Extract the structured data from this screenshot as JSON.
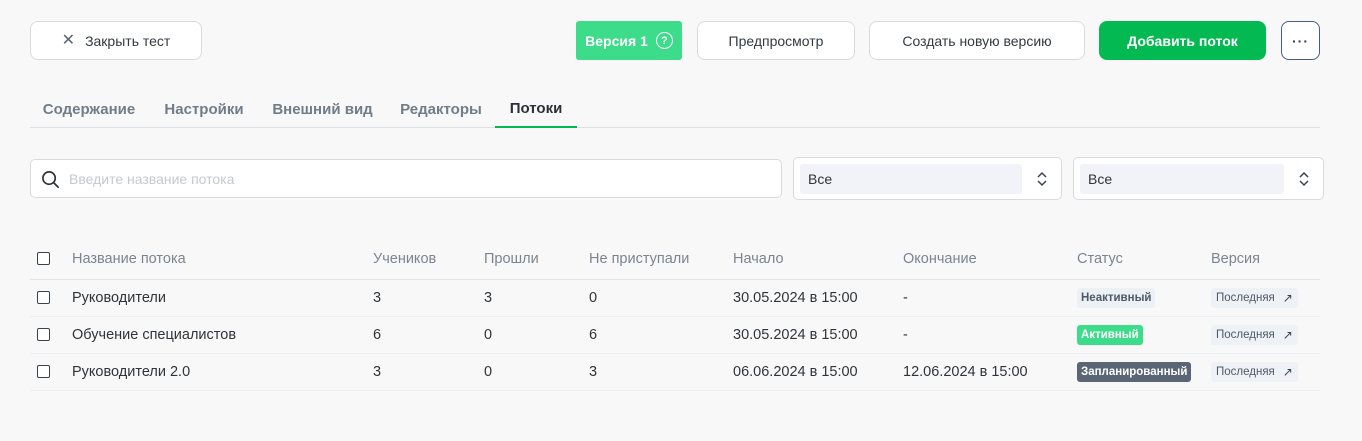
{
  "toolbar": {
    "close_label": "Закрыть тест",
    "version_label": "Версия 1",
    "preview_label": "Предпросмотр",
    "new_version_label": "Создать новую версию",
    "add_stream_label": "Добавить поток",
    "more_label": "···"
  },
  "tabs": [
    {
      "label": "Содержание",
      "active": false
    },
    {
      "label": "Настройки",
      "active": false
    },
    {
      "label": "Внешний вид",
      "active": false
    },
    {
      "label": "Редакторы",
      "active": false
    },
    {
      "label": "Потоки",
      "active": true
    }
  ],
  "filters": {
    "search_placeholder": "Введите название потока",
    "search_value": "",
    "select1_value": "Все",
    "select2_value": "Все"
  },
  "table": {
    "columns": [
      "Название потока",
      "Учеников",
      "Прошли",
      "Не приступали",
      "Начало",
      "Окончание",
      "Статус",
      "Версия"
    ],
    "rows": [
      {
        "name": "Руководители",
        "students": "3",
        "passed": "3",
        "not_started": "0",
        "start": "30.05.2024 в 15:00",
        "end": "-",
        "status": "Неактивный",
        "status_type": "inactive",
        "version": "Последняя"
      },
      {
        "name": "Обучение специалистов",
        "students": "6",
        "passed": "0",
        "not_started": "6",
        "start": "30.05.2024 в 15:00",
        "end": "-",
        "status": "Активный",
        "status_type": "active",
        "version": "Последняя"
      },
      {
        "name": "Руководители 2.0",
        "students": "3",
        "passed": "0",
        "not_started": "3",
        "start": "06.06.2024 в 15:00",
        "end": "12.06.2024 в 15:00",
        "status": "Запланированный",
        "status_type": "planned",
        "version": "Последняя"
      }
    ]
  },
  "colors": {
    "primary_green": "#03b952",
    "light_green": "#3ddc8a",
    "planned_gray": "#5a6676"
  }
}
